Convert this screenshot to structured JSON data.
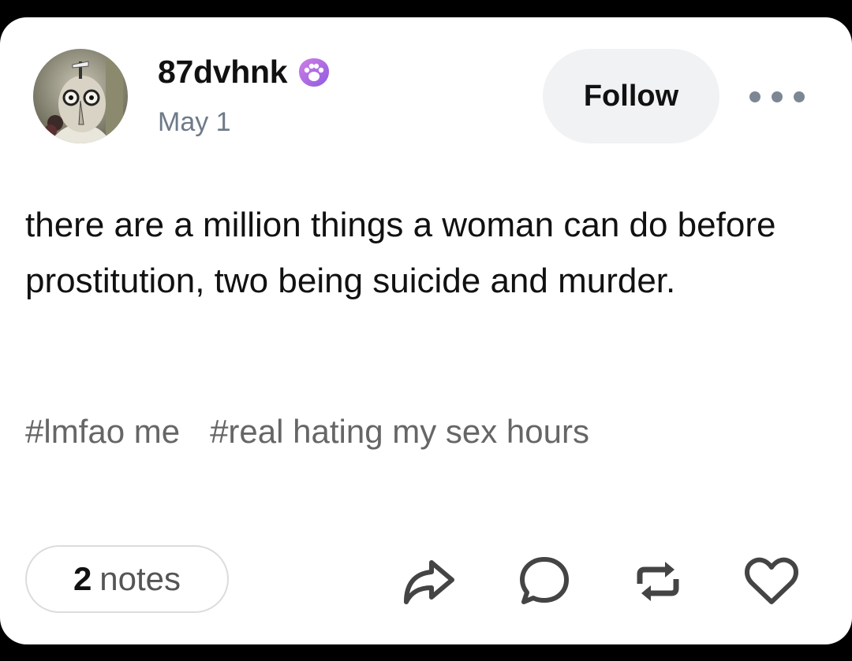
{
  "post": {
    "username": "87dvhnk",
    "badge_icon": "paw-badge-icon",
    "date": "May 1",
    "follow_label": "Follow",
    "more_icon": "more-dots-icon",
    "body": "there are a million things a woman can do before prostitution, two being suicide and murder.",
    "tags": [
      "#lmfao me",
      "#real hating my sex hours"
    ]
  },
  "footer": {
    "notes_count": "2",
    "notes_label": "notes",
    "actions": [
      "share-icon",
      "reply-icon",
      "reblog-icon",
      "like-icon"
    ]
  },
  "colors": {
    "background": "#000000",
    "card": "#ffffff",
    "follow_button": "#f1f2f4",
    "date_text": "#6e7a88",
    "tag_text": "#666666",
    "icon": "#444444",
    "badge": "#b86be8"
  }
}
